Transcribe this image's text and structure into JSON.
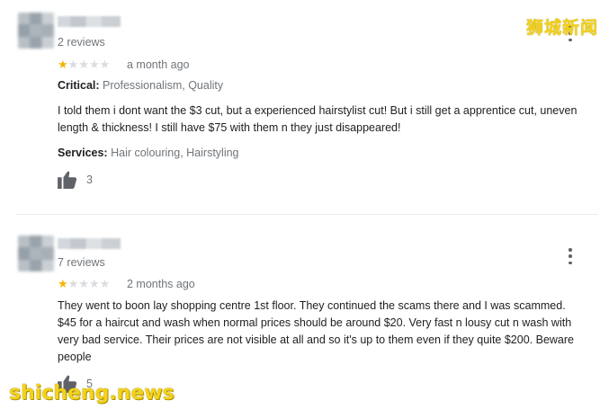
{
  "watermarks": {
    "top": "狮城新闻",
    "bottom": "shicheng.news"
  },
  "reviews": [
    {
      "reviews_count": "2 reviews",
      "rating": 1,
      "max_rating": 5,
      "date": "a month ago",
      "critical_label": "Critical:",
      "critical_value": "Professionalism, Quality",
      "text_lines": [
        "I told them i dont want the $3 cut, but a experienced hairstylist cut! But i still get a apprentice cut, uneven",
        "length & thickness! I still have $75 with them n they just disappeared!"
      ],
      "services_label": "Services:",
      "services_value": "Hair colouring, Hairstyling",
      "likes": "3"
    },
    {
      "reviews_count": "7 reviews",
      "rating": 1,
      "max_rating": 5,
      "date": "2 months ago",
      "text_lines": [
        "They went to boon lay shopping centre 1st floor. They continued the scams there and I was scammed.",
        "$45 for a haircut and wash when normal prices should be around $20. Very fast n lousy cut n wash with",
        "very bad service. Their prices are not visible at all and so it's up to them even if they quite $200. Beware",
        "people"
      ],
      "likes": "5"
    }
  ],
  "icons": {
    "like": "thumbs-up-icon",
    "more": "more-vert-icon",
    "star": "star-icon"
  },
  "colors": {
    "star_on": "#f4b400",
    "star_off": "#dadce0",
    "meta": "#70757a",
    "watermark": "#f5d21a"
  }
}
